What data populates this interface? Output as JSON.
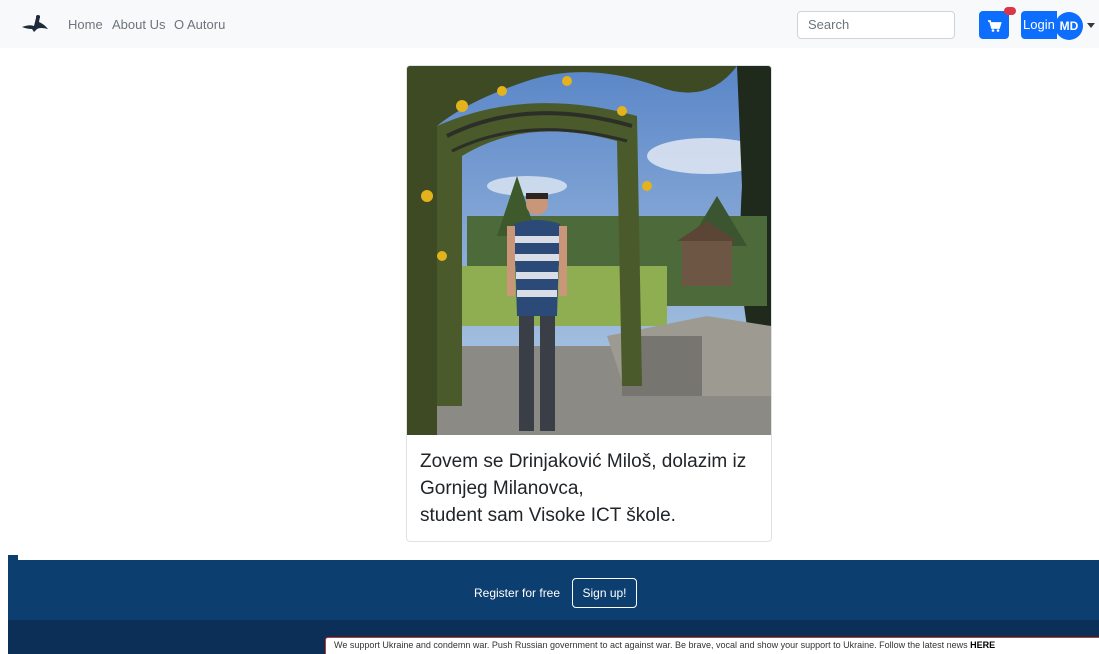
{
  "navbar": {
    "links": [
      "Home",
      "About Us",
      "O Autoru"
    ],
    "search_placeholder": "Search",
    "login_label": "Login",
    "avatar_initials": "MD",
    "colors": {
      "primary": "#0d6efd",
      "background": "#f8f9fa",
      "badge": "#dc3545"
    }
  },
  "card": {
    "lines": [
      "Zovem se Drinjaković Miloš, dolazim iz",
      "Gornjeg Milanovca,",
      "student sam Visoke ICT škole."
    ]
  },
  "footer": {
    "register_text": "Register for free",
    "signup_label": "Sign up!",
    "color": "#0d3e70"
  },
  "banner": {
    "text": "We support Ukraine and condemn war. Push Russian government to act against war. Be brave, vocal and show your support to Ukraine. Follow the latest news ",
    "link_text": "HERE"
  }
}
